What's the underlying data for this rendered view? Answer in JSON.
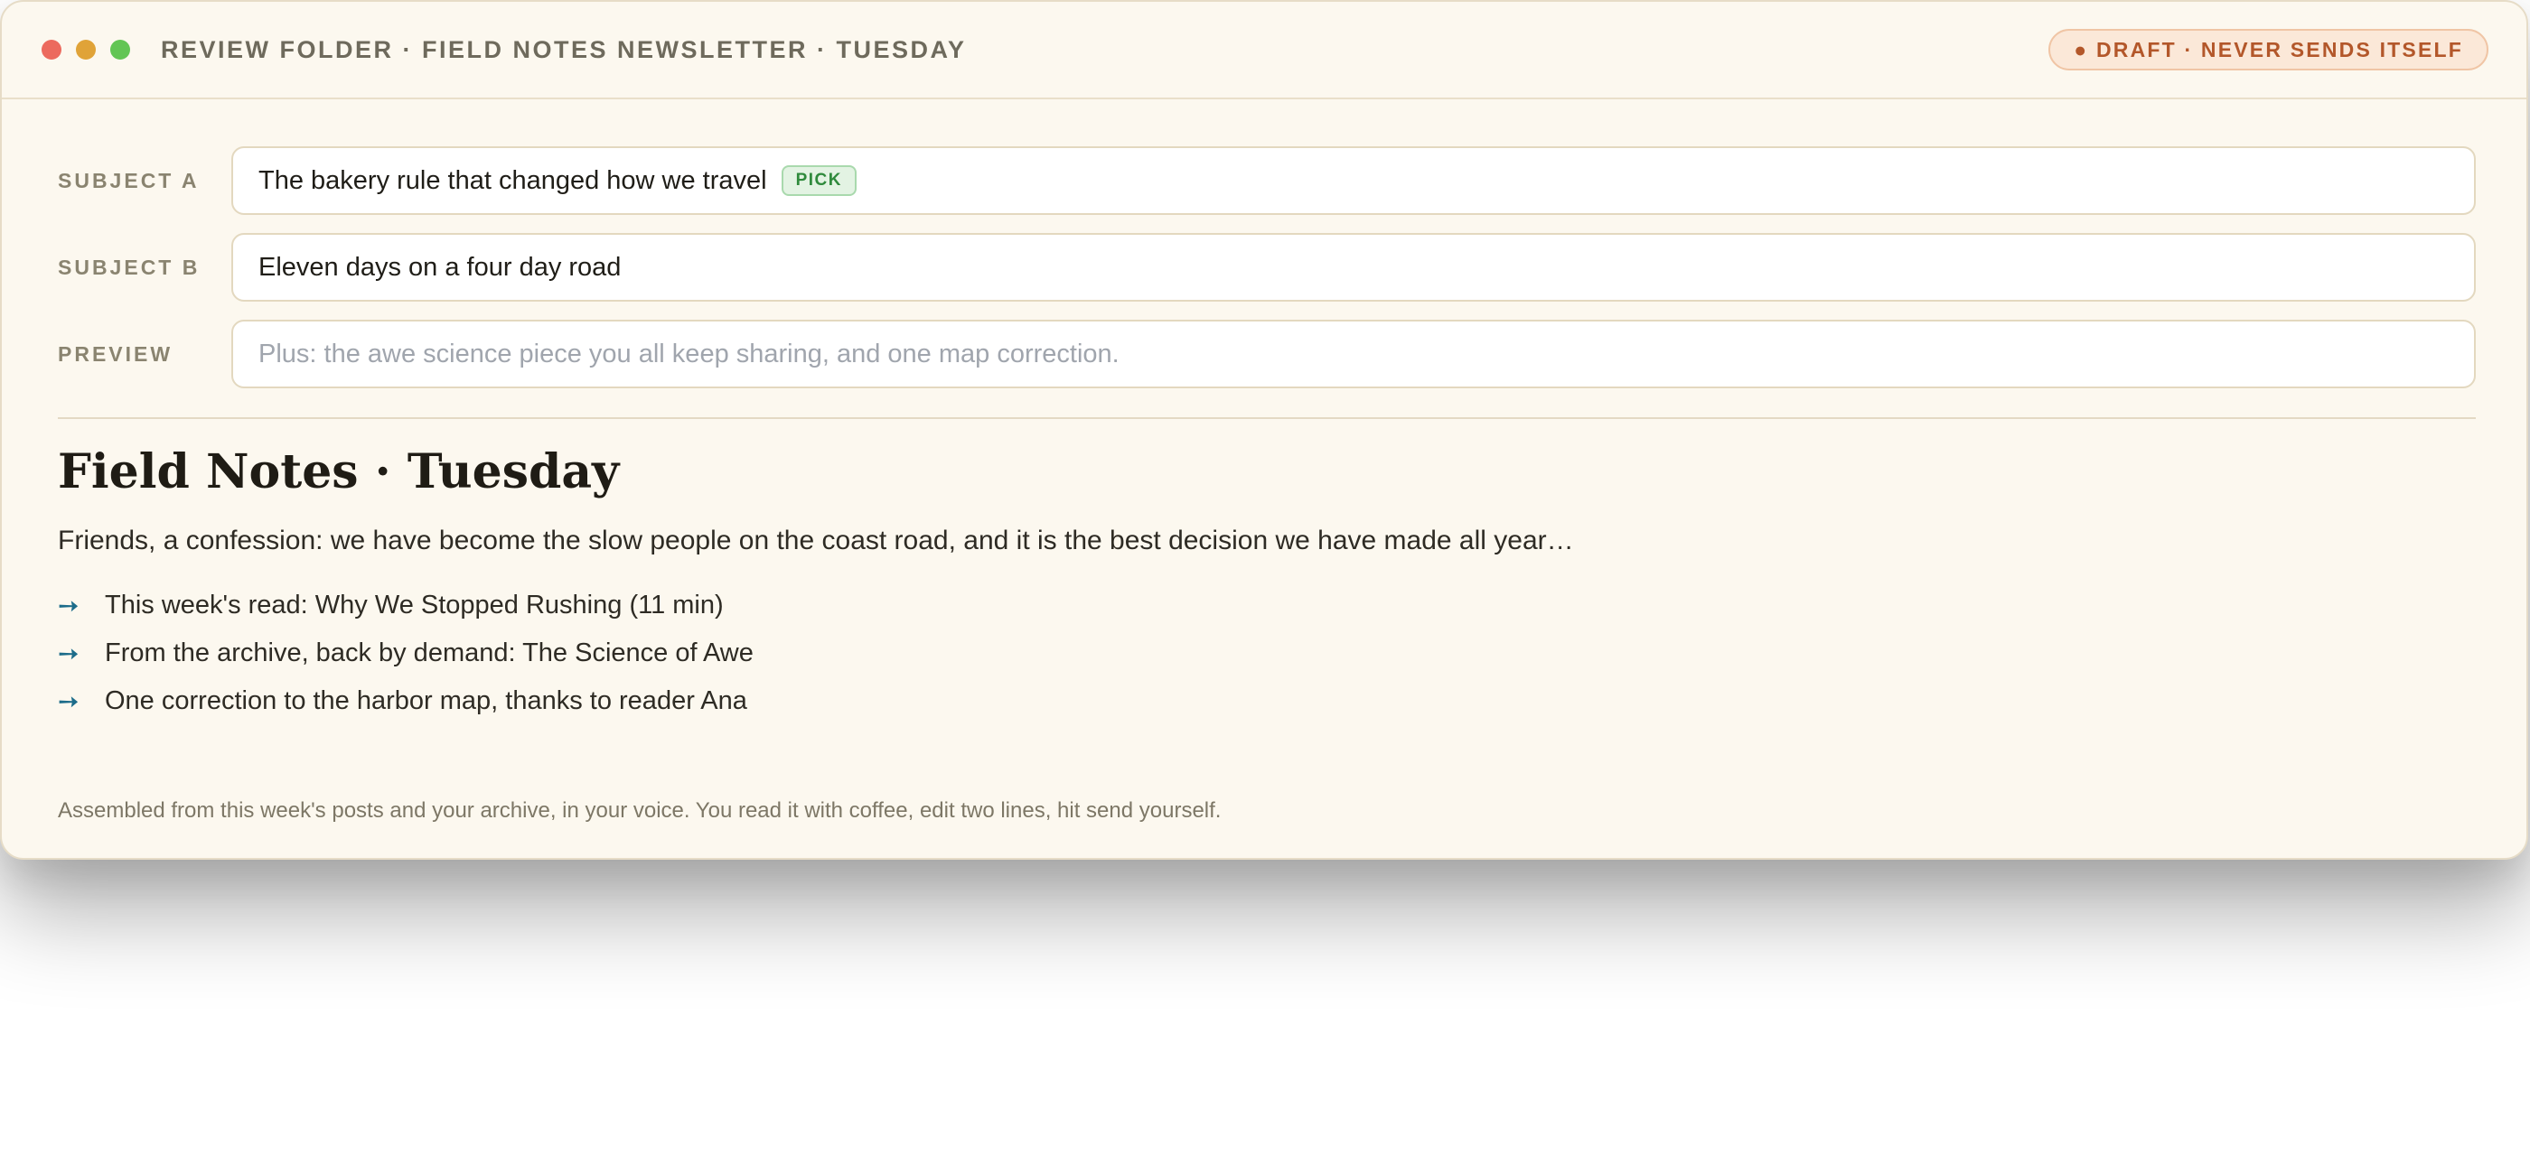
{
  "window": {
    "title": "REVIEW FOLDER · FIELD NOTES NEWSLETTER · TUESDAY",
    "badge": "● DRAFT · NEVER SENDS ITSELF"
  },
  "fields": {
    "subject_a": {
      "label": "SUBJECT A",
      "value": "The bakery rule that changed how we travel",
      "pick_label": "PICK"
    },
    "subject_b": {
      "label": "SUBJECT B",
      "value": "Eleven days on a four day road"
    },
    "preview": {
      "label": "PREVIEW",
      "placeholder": "Plus: the awe science piece you all keep sharing, and one map correction."
    }
  },
  "body": {
    "headline": "Field Notes · Tuesday",
    "intro": "Friends, a confession: we have become the slow people on the coast road, and it is the best decision we have made all year…",
    "links": [
      {
        "arrow": "➙",
        "text": "This week's read: Why We Stopped Rushing (11 min)"
      },
      {
        "arrow": "➙",
        "text": "From the archive, back by demand: The Science of Awe"
      },
      {
        "arrow": "➙",
        "text": "One correction to the harbor map, thanks to reader Ana"
      }
    ]
  },
  "footer": {
    "note": "Assembled from this week's posts and your archive, in your voice. You read it with coffee, edit two lines, hit send yourself."
  },
  "colors": {
    "window_bg": "#fcf8ef",
    "draft_accent": "#b3572a",
    "pick_accent": "#2f8a3c",
    "arrow_accent": "#1c6c8a"
  }
}
